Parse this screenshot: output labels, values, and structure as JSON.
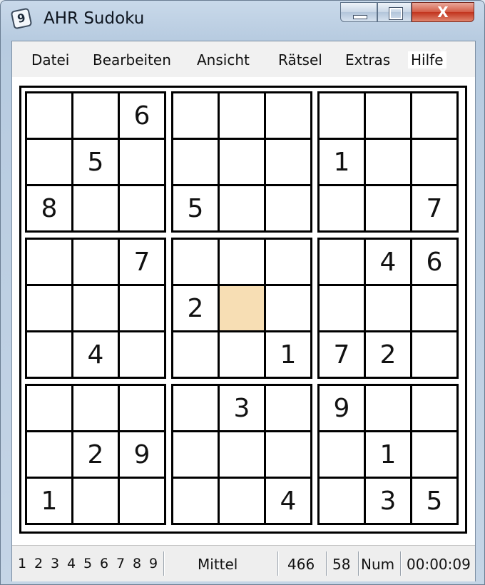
{
  "window": {
    "title": "AHR Sudoku",
    "app_icon_glyph": "9",
    "close_glyph": "X"
  },
  "menu": [
    "Datei",
    "Bearbeiten",
    "Ansicht",
    "Rätsel",
    "Extras",
    "Hilfe"
  ],
  "board": {
    "rows": [
      [
        "",
        "",
        "6",
        "",
        "",
        "",
        "",
        "",
        ""
      ],
      [
        "",
        "5",
        "",
        "",
        "",
        "",
        "1",
        "",
        ""
      ],
      [
        "8",
        "",
        "",
        "5",
        "",
        "",
        "",
        "",
        "7"
      ],
      [
        "",
        "",
        "7",
        "",
        "",
        "",
        "",
        "4",
        "6"
      ],
      [
        "",
        "",
        "",
        "2",
        "",
        "",
        "",
        "",
        ""
      ],
      [
        "",
        "4",
        "",
        "",
        "",
        "1",
        "7",
        "2",
        ""
      ],
      [
        "",
        "",
        "",
        "",
        "3",
        "",
        "9",
        "",
        ""
      ],
      [
        "",
        "2",
        "9",
        "",
        "",
        "",
        "",
        "1",
        ""
      ],
      [
        "1",
        "",
        "",
        "",
        "",
        "4",
        "",
        "3",
        "5"
      ]
    ],
    "selected": [
      4,
      4
    ],
    "selected_color": "#f7deb4"
  },
  "status": {
    "digits": [
      "1",
      "2",
      "3",
      "4",
      "5",
      "6",
      "7",
      "8",
      "9"
    ],
    "difficulty": "Mittel",
    "puzzle_number": "466",
    "count": "58",
    "num_lock": "Num",
    "timer": "00:00:09"
  }
}
